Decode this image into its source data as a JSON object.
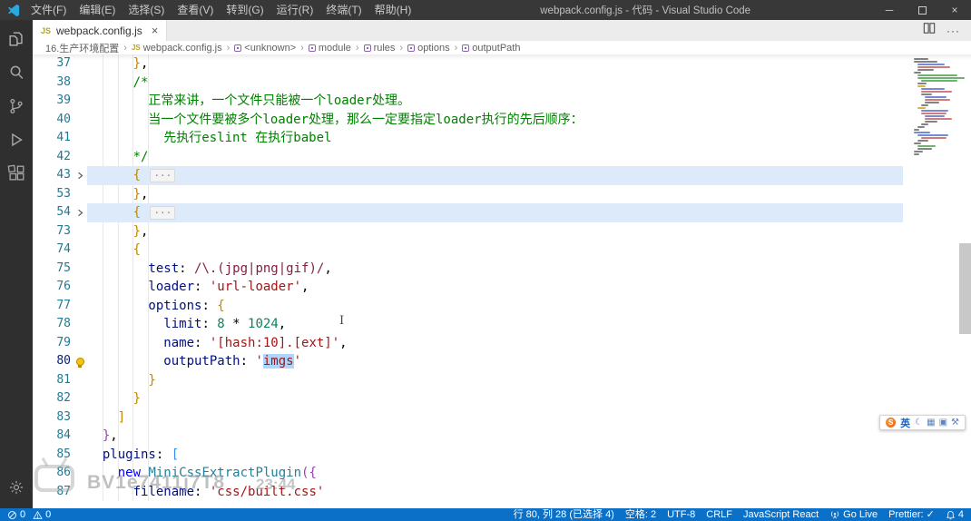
{
  "titlebar": {
    "title": "webpack.config.js - 代码 - Visual Studio Code",
    "menus": [
      {
        "id": "file",
        "label": "文件(F)"
      },
      {
        "id": "edit",
        "label": "编辑(E)"
      },
      {
        "id": "selection",
        "label": "选择(S)"
      },
      {
        "id": "view",
        "label": "查看(V)"
      },
      {
        "id": "go",
        "label": "转到(G)"
      },
      {
        "id": "run",
        "label": "运行(R)"
      },
      {
        "id": "terminal",
        "label": "终端(T)"
      },
      {
        "id": "help",
        "label": "帮助(H)"
      }
    ],
    "controls": {
      "minimize": "─",
      "close": "×"
    }
  },
  "activity_bar": {
    "items": [
      {
        "name": "explorer"
      },
      {
        "name": "search"
      },
      {
        "name": "source-control"
      },
      {
        "name": "run-and-debug"
      },
      {
        "name": "extensions"
      }
    ],
    "bottom": [
      {
        "name": "manage"
      }
    ]
  },
  "tab": {
    "label": "webpack.config.js",
    "close_glyph": "×",
    "icon_label": "JS"
  },
  "tab_actions": {
    "more_glyph": "···"
  },
  "ui": {
    "js_badge": "JS",
    "crumb_sep": "›"
  },
  "breadcrumbs": [
    {
      "id": "folder",
      "label": "16.生产环境配置",
      "icon": null
    },
    {
      "id": "file",
      "label": "webpack.config.js",
      "icon": "js"
    },
    {
      "id": "unknown",
      "label": "<unknown>",
      "icon": "sym"
    },
    {
      "id": "module",
      "label": "module",
      "icon": "sym"
    },
    {
      "id": "rules",
      "label": "rules",
      "icon": "sym"
    },
    {
      "id": "options",
      "label": "options",
      "icon": "sym"
    },
    {
      "id": "outputPath",
      "label": "outputPath",
      "icon": "sym"
    }
  ],
  "editor": {
    "active_line": 80,
    "selection_color": "#add6ff",
    "lines": [
      {
        "n": 37,
        "t": [
          [
            "b1",
            "      }"
          ],
          [
            "pun",
            ","
          ]
        ]
      },
      {
        "n": 38,
        "t": [
          [
            "cmt",
            "      /*"
          ]
        ]
      },
      {
        "n": 39,
        "t": [
          [
            "cmt",
            "        正常来讲，一个文件只能被一个loader处理。"
          ]
        ]
      },
      {
        "n": 40,
        "t": [
          [
            "cmt",
            "        当一个文件要被多个loader处理，那么一定要指定loader执行的先后顺序："
          ]
        ]
      },
      {
        "n": 41,
        "t": [
          [
            "cmt",
            "          先执行eslint 在执行babel"
          ]
        ]
      },
      {
        "n": 42,
        "t": [
          [
            "cmt",
            "      */"
          ]
        ]
      },
      {
        "n": 43,
        "fold": true,
        "band": true,
        "t": [
          [
            "b1",
            "      { "
          ],
          [
            "dots",
            "···"
          ]
        ]
      },
      {
        "n": 53,
        "t": [
          [
            "b1",
            "      }"
          ],
          [
            "pun",
            ","
          ]
        ]
      },
      {
        "n": 54,
        "fold": true,
        "band": true,
        "t": [
          [
            "b1",
            "      { "
          ],
          [
            "dots",
            "···"
          ]
        ]
      },
      {
        "n": 73,
        "t": [
          [
            "b1",
            "      }"
          ],
          [
            "pun",
            ","
          ]
        ]
      },
      {
        "n": 74,
        "t": [
          [
            "b1",
            "      {"
          ]
        ]
      },
      {
        "n": 75,
        "t": [
          [
            "prop",
            "        test"
          ],
          [
            "pun",
            ": "
          ],
          [
            "rgx",
            "/\\.(jpg|png|gif)/"
          ],
          [
            "pun",
            ","
          ]
        ]
      },
      {
        "n": 76,
        "t": [
          [
            "prop",
            "        loader"
          ],
          [
            "pun",
            ": "
          ],
          [
            "str",
            "'url-loader'"
          ],
          [
            "pun",
            ","
          ]
        ]
      },
      {
        "n": 77,
        "t": [
          [
            "prop",
            "        options"
          ],
          [
            "pun",
            ": "
          ],
          [
            "b1",
            "{"
          ]
        ]
      },
      {
        "n": 78,
        "t": [
          [
            "prop",
            "          limit"
          ],
          [
            "pun",
            ": "
          ],
          [
            "num",
            "8"
          ],
          [
            "pun",
            " * "
          ],
          [
            "num",
            "1024"
          ],
          [
            "pun",
            ","
          ]
        ]
      },
      {
        "n": 79,
        "t": [
          [
            "prop",
            "          name"
          ],
          [
            "pun",
            ": "
          ],
          [
            "str",
            "'[hash:10].[ext]'"
          ],
          [
            "pun",
            ","
          ]
        ]
      },
      {
        "n": 80,
        "bulb": true,
        "t": [
          [
            "prop",
            "          outputPath"
          ],
          [
            "pun",
            ": "
          ],
          [
            "str",
            "'"
          ],
          [
            "sel",
            "imgs"
          ],
          [
            "str",
            "'"
          ]
        ]
      },
      {
        "n": 81,
        "t": [
          [
            "b1",
            "        }"
          ]
        ]
      },
      {
        "n": 82,
        "t": [
          [
            "b1",
            "      }"
          ]
        ]
      },
      {
        "n": 83,
        "t": [
          [
            "b1",
            "    ]"
          ]
        ]
      },
      {
        "n": 84,
        "t": [
          [
            "b2",
            "  }"
          ],
          [
            "pun",
            ","
          ]
        ]
      },
      {
        "n": 85,
        "t": [
          [
            "prop",
            "  plugins"
          ],
          [
            "pun",
            ": "
          ],
          [
            "b3",
            "["
          ]
        ]
      },
      {
        "n": 86,
        "t": [
          [
            "pun",
            "    "
          ],
          [
            "kw",
            "new"
          ],
          [
            "cls",
            " MiniCssExtractPlugin"
          ],
          [
            "b2",
            "({"
          ]
        ]
      },
      {
        "n": 87,
        "t": [
          [
            "prop",
            "      filename"
          ],
          [
            "pun",
            ": "
          ],
          [
            "str",
            "'css/built.css'"
          ]
        ]
      }
    ]
  },
  "minimap": {
    "rows": [
      [
        2,
        16,
        "k"
      ],
      [
        2,
        26,
        "k"
      ],
      [
        4,
        30,
        "b"
      ],
      [
        4,
        36,
        "r"
      ],
      [
        4,
        18,
        "k"
      ],
      [
        2,
        8,
        "k"
      ],
      [
        4,
        44,
        "g"
      ],
      [
        4,
        52,
        "g"
      ],
      [
        6,
        40,
        "g"
      ],
      [
        4,
        10,
        "k"
      ],
      [
        4,
        9,
        "o"
      ],
      [
        6,
        26,
        "b"
      ],
      [
        6,
        34,
        "r"
      ],
      [
        6,
        12,
        "k"
      ],
      [
        8,
        24,
        "b"
      ],
      [
        8,
        28,
        "r"
      ],
      [
        8,
        16,
        "k"
      ],
      [
        6,
        8,
        "k"
      ],
      [
        4,
        9,
        "o"
      ],
      [
        6,
        30,
        "b"
      ],
      [
        6,
        28,
        "r"
      ],
      [
        8,
        22,
        "b"
      ],
      [
        8,
        30,
        "r"
      ],
      [
        8,
        14,
        "k"
      ],
      [
        6,
        8,
        "k"
      ],
      [
        4,
        8,
        "k"
      ],
      [
        2,
        6,
        "k"
      ],
      [
        2,
        18,
        "b"
      ],
      [
        4,
        34,
        "b"
      ],
      [
        6,
        28,
        "r"
      ],
      [
        4,
        12,
        "k"
      ],
      [
        2,
        8,
        "k"
      ],
      [
        4,
        20,
        "g"
      ],
      [
        4,
        16,
        "k"
      ],
      [
        2,
        10,
        "k"
      ],
      [
        2,
        6,
        "k"
      ]
    ]
  },
  "ime": {
    "logo_text": "S",
    "lang": "英",
    "tools": [
      "☾",
      "▦",
      "▣",
      "⚒"
    ]
  },
  "watermark": {
    "id": "BV1e7411j7T8",
    "time": "23:44"
  },
  "cursor_glyph": "I",
  "status_bar": {
    "left": [
      {
        "name": "problems-errors",
        "icon": "error",
        "label": "0"
      },
      {
        "name": "problems-warnings",
        "icon": "warning",
        "label": "0"
      }
    ],
    "right": [
      {
        "name": "cursor-position",
        "icon": null,
        "label": "行 80, 列 28 (已选择 4)"
      },
      {
        "name": "indentation",
        "icon": null,
        "label": "空格: 2"
      },
      {
        "name": "encoding",
        "icon": null,
        "label": "UTF-8"
      },
      {
        "name": "eol",
        "icon": null,
        "label": "CRLF"
      },
      {
        "name": "language-mode",
        "icon": null,
        "label": "JavaScript React"
      },
      {
        "name": "go-live",
        "icon": "golive",
        "label": "Go Live"
      },
      {
        "name": "prettier",
        "icon": null,
        "label": "Prettier: ✓"
      },
      {
        "name": "notifications",
        "icon": "bell",
        "label": "4"
      }
    ]
  }
}
